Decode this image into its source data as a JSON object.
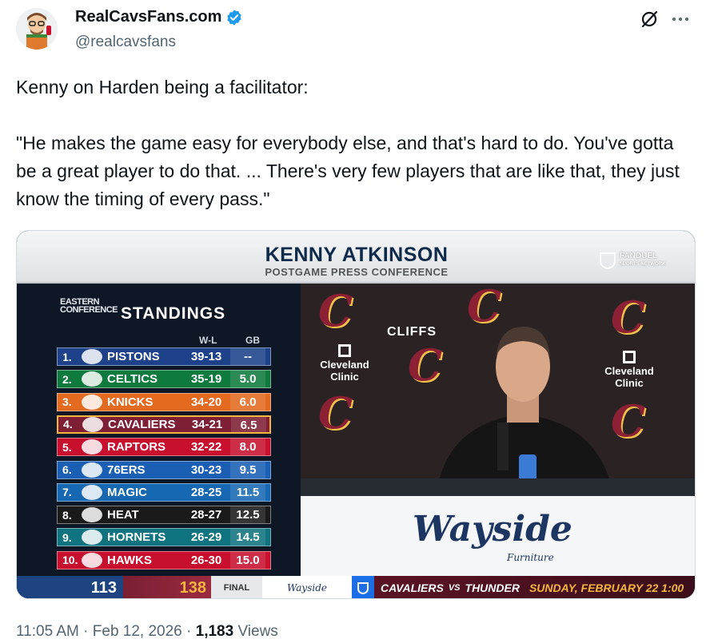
{
  "author": {
    "display_name": "RealCavsFans.com",
    "handle": "@realcavsfans",
    "verified": true,
    "avatar_icon": "cartoon-avatar-icon"
  },
  "actions": {
    "grok_icon": "grok-icon",
    "more_icon": "more-icon"
  },
  "tweet": {
    "text": "Kenny on Harden being a facilitator:\n\n\"He makes the game easy for everybody else, and that's hard to do. You've gotta be a great player to do that. ... There's very few players that are like that, they just know the timing of every pass.\""
  },
  "media": {
    "banner": {
      "name": "KENNY ATKINSON",
      "subtitle": "POSTGAME PRESS CONFERENCE",
      "network": "FANDUEL",
      "network_sub": "SPORTS NETWORK"
    },
    "standings": {
      "conference": "EASTERN CONFERENCE",
      "title": "STANDINGS",
      "col_wl": "W-L",
      "col_gb": "GB",
      "rows": [
        {
          "rank": "1.",
          "team": "PISTONS",
          "wl": "39-13",
          "gb": "--",
          "color": "#1d428a"
        },
        {
          "rank": "2.",
          "team": "CELTICS",
          "wl": "35-19",
          "gb": "5.0",
          "color": "#0f7a3e"
        },
        {
          "rank": "3.",
          "team": "KNICKS",
          "wl": "34-20",
          "gb": "6.0",
          "color": "#e46a1f"
        },
        {
          "rank": "4.",
          "team": "CAVALIERS",
          "wl": "34-21",
          "gb": "6.5",
          "color": "#7e1f35"
        },
        {
          "rank": "5.",
          "team": "RAPTORS",
          "wl": "32-22",
          "gb": "8.0",
          "color": "#c8102e"
        },
        {
          "rank": "6.",
          "team": "76ERS",
          "wl": "30-23",
          "gb": "9.5",
          "color": "#1a5fb4"
        },
        {
          "rank": "7.",
          "team": "MAGIC",
          "wl": "28-25",
          "gb": "11.5",
          "color": "#1668b3"
        },
        {
          "rank": "8.",
          "team": "HEAT",
          "wl": "28-27",
          "gb": "12.5",
          "color": "#1a1a1a"
        },
        {
          "rank": "9.",
          "team": "HORNETS",
          "wl": "26-29",
          "gb": "14.5",
          "color": "#0f7480"
        },
        {
          "rank": "10.",
          "team": "HAWKS",
          "wl": "26-30",
          "gb": "15.0",
          "color": "#c8102e"
        }
      ]
    },
    "backdrop": {
      "cliffs": "CLIFFS",
      "clinic": "Cleveland Clinic"
    },
    "sponsor": {
      "name": "Wayside",
      "sub": "Furniture"
    },
    "ticker": {
      "away_score": "113",
      "home_score": "138",
      "status": "FINAL",
      "sponsor": "Wayside",
      "promo_team1": "CAVALIERS",
      "promo_vs": "VS",
      "promo_team2": "THUNDER",
      "promo_date": "SUNDAY, FEBRUARY 22 1:00"
    }
  },
  "footer": {
    "time": "11:05 AM",
    "sep1": " · ",
    "date": "Feb 12, 2026",
    "sep2": " · ",
    "views_count": "1,183",
    "views_label": " Views"
  }
}
